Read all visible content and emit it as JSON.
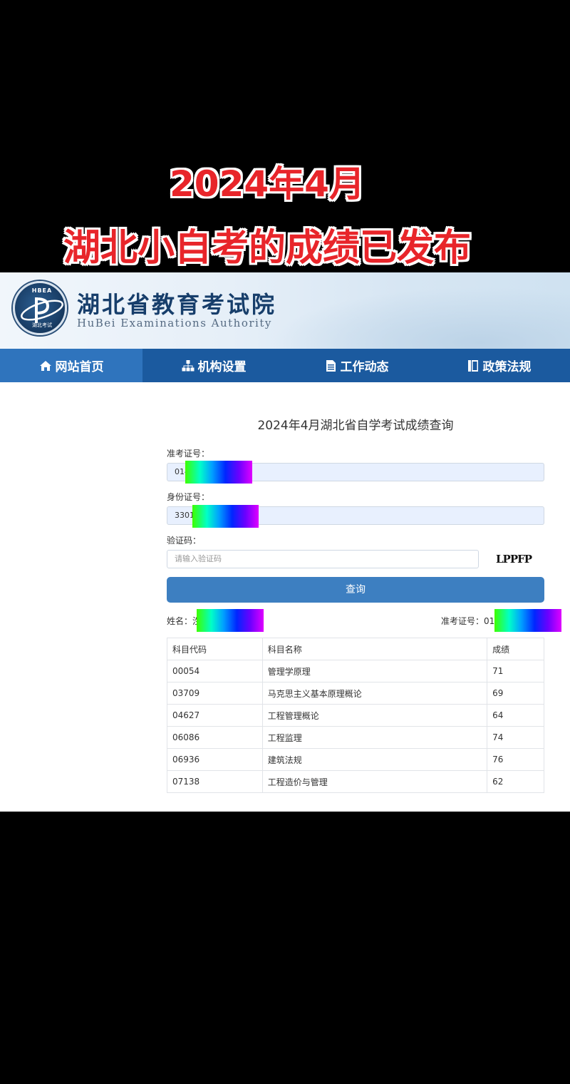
{
  "overlay": {
    "line1": "2024年4月",
    "line2": "湖北小自考的成绩已发布"
  },
  "header": {
    "logo_top": "HBEA",
    "logo_bottom": "湖北考试",
    "title_cn": "湖北省教育考试院",
    "title_en": "HuBei Examinations Authority"
  },
  "nav": {
    "items": [
      {
        "label": "网站首页",
        "icon": "home-icon"
      },
      {
        "label": "机构设置",
        "icon": "org-chart-icon"
      },
      {
        "label": "工作动态",
        "icon": "document-icon"
      },
      {
        "label": "政策法规",
        "icon": "book-icon"
      }
    ]
  },
  "form": {
    "title": "2024年4月湖北省自学考试成绩查询",
    "admission_label": "准考证号：",
    "admission_value": "014",
    "id_label": "身份证号：",
    "id_value": "3301",
    "captcha_label": "验证码：",
    "captcha_placeholder": "请输入验证码",
    "captcha_image_text": "LPPFP",
    "submit_label": "查询"
  },
  "result": {
    "name_label": "姓名：泩",
    "admission_label": "准考证号：01"
  },
  "table": {
    "headers": [
      "科目代码",
      "科目名称",
      "成绩"
    ],
    "rows": [
      [
        "00054",
        "管理学原理",
        "71"
      ],
      [
        "03709",
        "马克思主义基本原理概论",
        "69"
      ],
      [
        "04627",
        "工程管理概论",
        "64"
      ],
      [
        "06086",
        "工程监理",
        "74"
      ],
      [
        "06936",
        "建筑法规",
        "76"
      ],
      [
        "07138",
        "工程造价与管理",
        "62"
      ]
    ]
  },
  "colors": {
    "nav_bg": "#1b5a9f",
    "nav_active": "#2f74bd",
    "button": "#3d7fc1",
    "overlay_text": "#e8252a"
  }
}
